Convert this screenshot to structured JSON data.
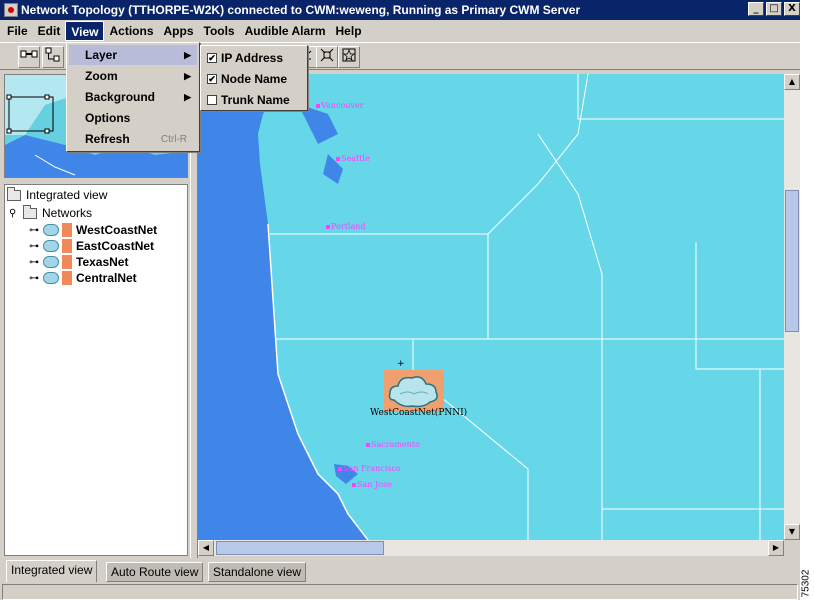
{
  "window": {
    "title": "Network Topology  (TTHORPE-W2K) connected to CWM:weweng, Running as Primary CWM Server",
    "controls": {
      "minimize": "_",
      "maximize": "□",
      "close": "X"
    }
  },
  "menubar": {
    "items": [
      {
        "label": "File",
        "key": "F"
      },
      {
        "label": "Edit",
        "key": "E"
      },
      {
        "label": "View",
        "key": "V"
      },
      {
        "label": "Actions",
        "key": "A"
      },
      {
        "label": "Apps",
        "key": "A"
      },
      {
        "label": "Tools",
        "key": "T"
      },
      {
        "label": "Audible Alarm",
        "key": "A"
      },
      {
        "label": "Help",
        "key": "H"
      }
    ]
  },
  "view_menu": {
    "items": [
      {
        "label": "Layer",
        "submenu": true
      },
      {
        "label": "Zoom",
        "submenu": true
      },
      {
        "label": "Background",
        "submenu": true
      },
      {
        "label": "Options"
      },
      {
        "label": "Refresh",
        "accelerator": "Ctrl-R"
      }
    ]
  },
  "layer_submenu": {
    "items": [
      {
        "label": "IP Address",
        "checked": true
      },
      {
        "label": "Node Name",
        "checked": true
      },
      {
        "label": "Trunk Name",
        "checked": false
      }
    ]
  },
  "tree": {
    "root": "Integrated view",
    "folder": "Networks",
    "networks": [
      "WestCoastNet",
      "EastCoastNet",
      "TexasNet",
      "CentralNet"
    ]
  },
  "map": {
    "cities": [
      "Vancouver",
      "Seattle",
      "Portland",
      "Sacramento",
      "San Francisco",
      "San Jose"
    ],
    "node_label": "WestCoastNet(PNNI)",
    "colors": {
      "ocean": "#3f86e8",
      "land": "#66d7e8",
      "city": "#ff40ff",
      "node_bg": "#f0a070"
    }
  },
  "tabs": [
    "Integrated view",
    "Auto Route view",
    "Standalone view"
  ],
  "figure_id": "75302"
}
